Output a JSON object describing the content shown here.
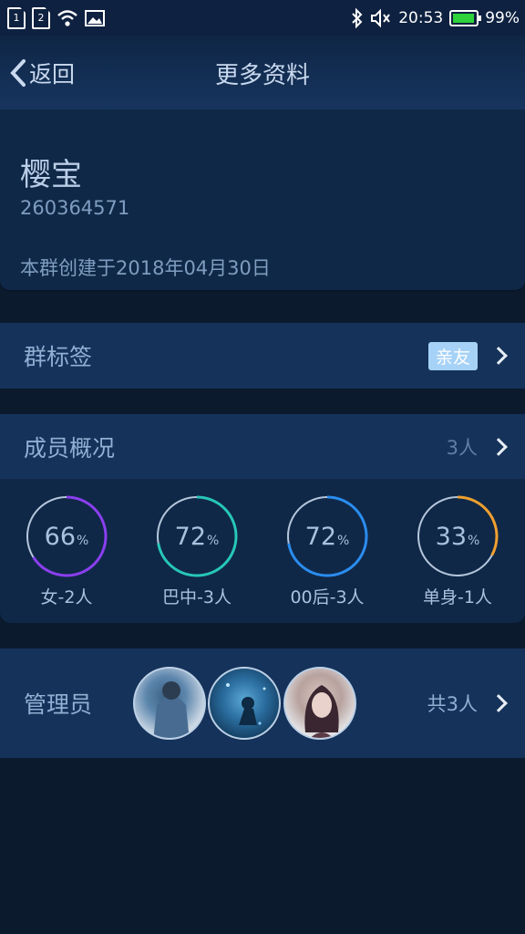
{
  "status_bar": {
    "sim1": "1",
    "sim2": "2",
    "time": "20:53",
    "battery": "99%",
    "icons": [
      "sim1-icon",
      "sim2-icon",
      "wifi-icon",
      "image-icon",
      "bluetooth-icon",
      "mute-icon",
      "battery-icon"
    ]
  },
  "nav": {
    "back_label": "返回",
    "title": "更多资料"
  },
  "group": {
    "name": "樱宝",
    "id": "260364571",
    "created": "本群创建于2018年04月30日"
  },
  "tags_row": {
    "label": "群标签",
    "tag": "亲友"
  },
  "members_row": {
    "label": "成员概况",
    "count": "3人"
  },
  "stats": [
    {
      "percent": 66,
      "value": "66",
      "unit": "%",
      "label": "女-2人",
      "color": "#8a3ff0"
    },
    {
      "percent": 72,
      "value": "72",
      "unit": "%",
      "label": "巴中-3人",
      "color": "#27c7b8"
    },
    {
      "percent": 72,
      "value": "72",
      "unit": "%",
      "label": "00后-3人",
      "color": "#2a8df0"
    },
    {
      "percent": 33,
      "value": "33",
      "unit": "%",
      "label": "单身-1人",
      "color": "#f0a030"
    }
  ],
  "admins_row": {
    "label": "管理员",
    "count": "共3人"
  },
  "colors": {
    "background": "#0c1a2e",
    "row": "#15325a",
    "card": "#102847",
    "tag_badge": "#a6d2f7"
  }
}
